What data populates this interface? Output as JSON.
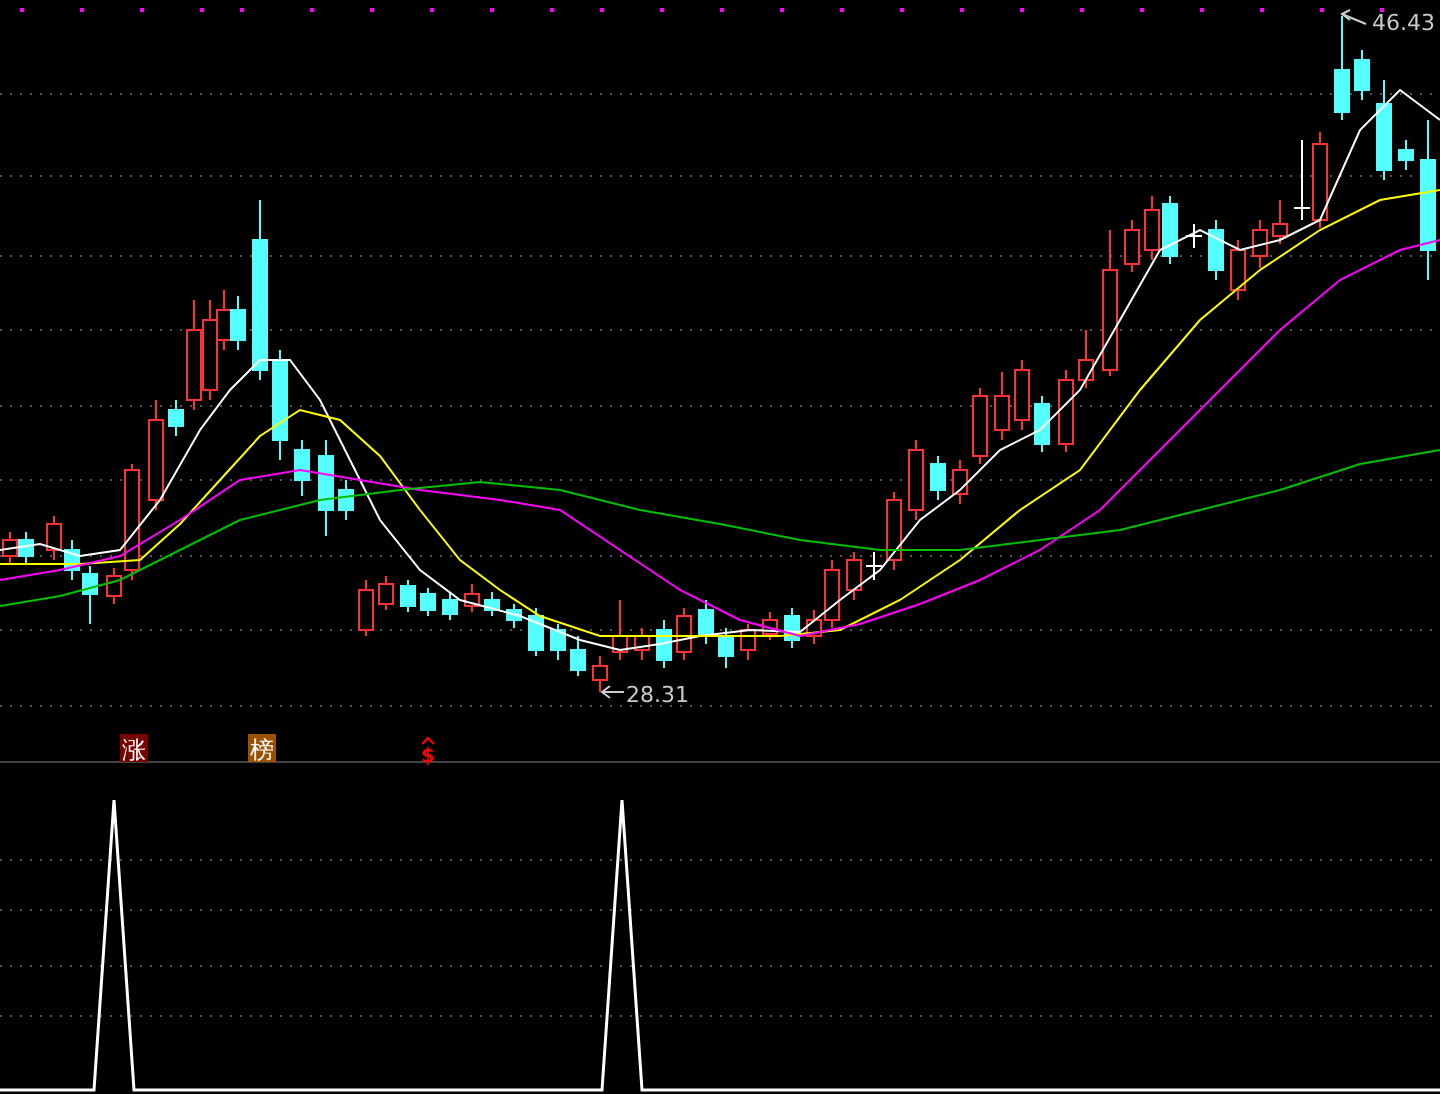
{
  "chart": {
    "high_label": "46.43",
    "low_label": "28.31"
  },
  "signals": [
    {
      "label": "涨",
      "kind": "badge",
      "color": "#7a0000"
    },
    {
      "label": "榜",
      "kind": "badge",
      "color": "#9a5200"
    },
    {
      "label": "$",
      "kind": "mark",
      "color": "#ff0000"
    }
  ]
}
